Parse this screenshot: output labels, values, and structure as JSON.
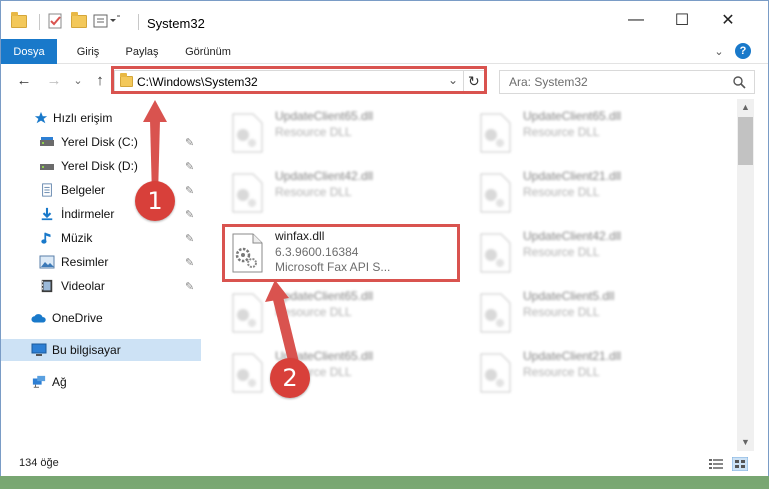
{
  "window": {
    "title": "System32",
    "minimize": "—",
    "maximize": "☐",
    "close": "✕"
  },
  "ribbon": {
    "tabs": [
      {
        "label": "Dosya",
        "active": true
      },
      {
        "label": "Giriş"
      },
      {
        "label": "Paylaş"
      },
      {
        "label": "Görünüm"
      }
    ],
    "expand": "⌄",
    "help": "?"
  },
  "nav": {
    "back": "←",
    "forward": "→",
    "recent": "⌄",
    "up": "↑",
    "address": "C:\\Windows\\System32",
    "dropdown": "⌄",
    "refresh": "↻",
    "search_placeholder": "Ara: System32"
  },
  "sidebar": {
    "items": [
      {
        "label": "Hızlı erişim",
        "icon": "star-icon"
      },
      {
        "label": "Yerel Disk (C:)",
        "icon": "drive-icon",
        "pinned": true
      },
      {
        "label": "Yerel Disk (D:)",
        "icon": "drive-icon",
        "pinned": true
      },
      {
        "label": "Belgeler",
        "icon": "documents-icon",
        "pinned": true
      },
      {
        "label": "İndirmeler",
        "icon": "download-icon",
        "pinned": true
      },
      {
        "label": "Müzik",
        "icon": "music-icon",
        "pinned": true
      },
      {
        "label": "Resimler",
        "icon": "pictures-icon",
        "pinned": true
      },
      {
        "label": "Videolar",
        "icon": "videos-icon",
        "pinned": true
      },
      {
        "label": "OneDrive",
        "icon": "cloud-icon"
      },
      {
        "label": "Bu bilgisayar",
        "icon": "computer-icon",
        "selected": true
      },
      {
        "label": "Ağ",
        "icon": "network-icon"
      }
    ],
    "pin_glyph": "📌"
  },
  "files": {
    "left": [
      {
        "name": "UpdateClient65.dll",
        "desc": "Resource DLL"
      },
      {
        "name": "UpdateClient42.dll",
        "desc": "Resource DLL"
      },
      {
        "name": "winfax.dll",
        "version": "6.3.9600.16384",
        "desc": "Microsoft Fax API S...",
        "highlighted": true
      },
      {
        "name": "UpdateClient65.dll",
        "desc": "Resource DLL"
      },
      {
        "name": "UpdateClient65.dll",
        "desc": "Resource DLL"
      }
    ],
    "right": [
      {
        "name": "UpdateClient65.dll",
        "desc": "Resource DLL"
      },
      {
        "name": "UpdateClient21.dll",
        "desc": "Resource DLL"
      },
      {
        "name": "UpdateClient42.dll",
        "desc": "Resource DLL"
      },
      {
        "name": "UpdateClient5.dll",
        "desc": "Resource DLL"
      },
      {
        "name": "UpdateClient21.dll",
        "desc": "Resource DLL"
      }
    ]
  },
  "status": {
    "count": "134 öğe"
  },
  "annotations": {
    "step1": "1",
    "step2": "2",
    "color": "#d9534f"
  }
}
